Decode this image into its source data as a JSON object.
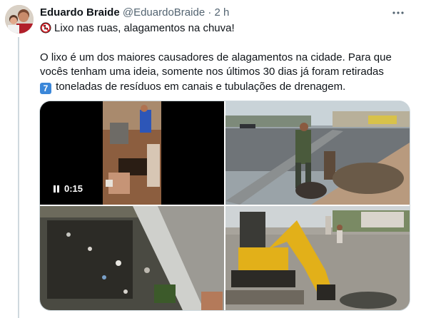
{
  "tweet": {
    "author_name": "Eduardo Braide",
    "handle": "@EduardoBraide",
    "separator": "·",
    "time": "2 h",
    "line1": "Lixo nas ruas, alagamentos na chuva!",
    "line2": "O lixo é um dos maiores causadores de alagamentos na cidade. Para que",
    "line3": "vocês tenham uma ideia, somente nos últimos 30 dias já foram retiradas",
    "line4_emoji": "7",
    "line4": "toneladas de resíduos em canais e tubulações de drenagem.",
    "video_duration": "0:15"
  },
  "icons": {
    "more": "more-dots-icon",
    "play": "pause-icon",
    "trash": "no-littering-icon"
  }
}
